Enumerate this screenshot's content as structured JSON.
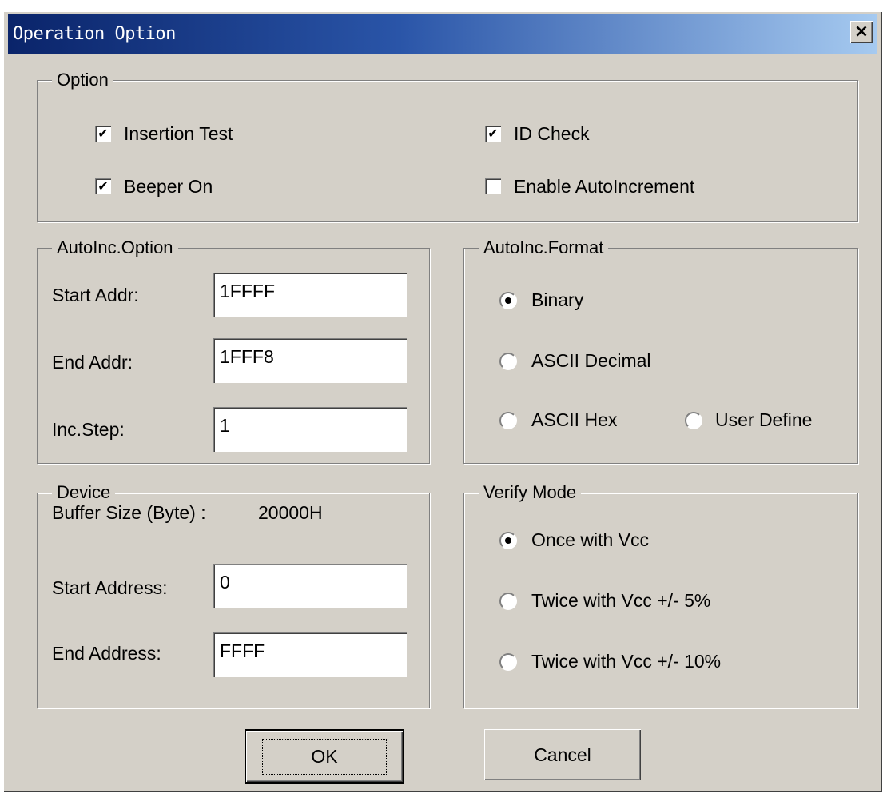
{
  "window": {
    "title": "Operation Option",
    "close_label": "×"
  },
  "option_group": {
    "legend": "Option",
    "checkboxes": [
      {
        "label": "Insertion Test",
        "checked": true
      },
      {
        "label": "ID Check",
        "checked": true
      },
      {
        "label": "Beeper On",
        "checked": true
      },
      {
        "label": "Enable AutoIncrement",
        "checked": false
      }
    ]
  },
  "autoinc_option": {
    "legend": "AutoInc.Option",
    "fields": [
      {
        "label": "Start Addr:",
        "value": "1FFFF"
      },
      {
        "label": "End Addr:",
        "value": "1FFF8"
      },
      {
        "label": "Inc.Step:",
        "value": "1"
      }
    ]
  },
  "autoinc_format": {
    "legend": "AutoInc.Format",
    "options": [
      {
        "label": "Binary",
        "selected": true
      },
      {
        "label": "ASCII Decimal",
        "selected": false
      },
      {
        "label": "ASCII Hex",
        "selected": false
      },
      {
        "label": "User Define",
        "selected": false
      }
    ]
  },
  "device": {
    "legend": "Device",
    "buffer_size_label": "Buffer Size (Byte) :",
    "buffer_size_value": "20000H",
    "fields": [
      {
        "label": "Start Address:",
        "value": "0"
      },
      {
        "label": "End Address:",
        "value": "FFFF"
      }
    ]
  },
  "verify_mode": {
    "legend": "Verify Mode",
    "options": [
      {
        "label": "Once with Vcc",
        "selected": true
      },
      {
        "label": "Twice with Vcc +/- 5%",
        "selected": false
      },
      {
        "label": "Twice with Vcc +/- 10%",
        "selected": false
      }
    ]
  },
  "buttons": {
    "ok": "OK",
    "cancel": "Cancel"
  }
}
